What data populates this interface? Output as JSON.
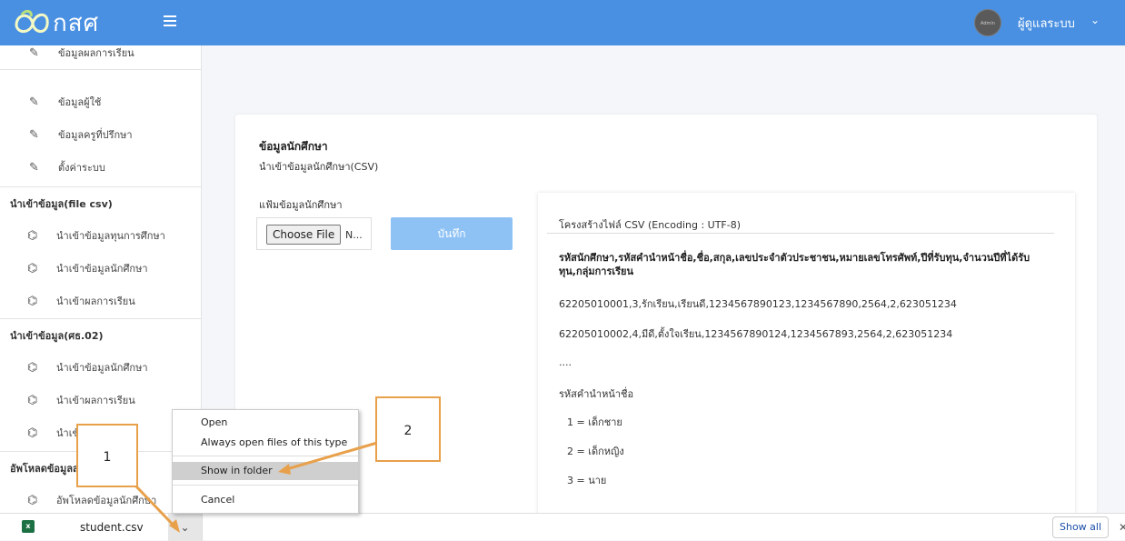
{
  "header": {
    "logo_text": "กสศ",
    "menu_icon": "hamburger-icon",
    "avatar_text": "Admin",
    "user_label": "ผู้ดูแลระบบ",
    "user_caret": "⌄",
    "colors": {
      "topbar": "#4a90e2",
      "save_button": "#8ec2f5"
    }
  },
  "sidebar": {
    "top_item": "ข้อมูลผลการเรียน",
    "items": [
      {
        "label": "ข้อมูลผู้ใช้",
        "icon": "edit-icon"
      },
      {
        "label": "ข้อมูลครูที่ปรึกษา",
        "icon": "edit-icon"
      },
      {
        "label": "ตั้งค่าระบบ",
        "icon": "edit-icon"
      }
    ],
    "sections": [
      {
        "title": "นำเข้าข้อมูล(file csv)",
        "items": [
          {
            "label": "นำเข้าข้อมูลทุนการศึกษา"
          },
          {
            "label": "นำเข้าข้อมูลนักศึกษา"
          },
          {
            "label": "นำเข้าผลการเรียน"
          }
        ]
      },
      {
        "title": "นำเข้าข้อมูล(ศธ.02)",
        "items": [
          {
            "label": "นำเข้าข้อมูลนักศึกษา"
          },
          {
            "label": "นำเข้าผลการเรียน"
          },
          {
            "label": "นำเข้าผลการเรียน"
          }
        ]
      },
      {
        "title": "อัพโหลดข้อมูลส่วนกลาง",
        "items": [
          {
            "label": "อัพโหลดข้อมูลนักศึกษา"
          }
        ]
      }
    ]
  },
  "main": {
    "title": "ข้อมูลนักศึกษา",
    "subtitle": "นำเข้าข้อมูลนักศึกษา(CSV)",
    "file_label": "แฟ้มข้อมูลนักศึกษา",
    "choose_file": "Choose File",
    "file_status": "N...",
    "save_label": "บันทึก",
    "info": {
      "title": "โครงสร้างไฟล์ CSV (Encoding : UTF-8)",
      "header_line": "รหัสนักศึกษา,รหัสคำนำหน้าชื่อ,ชื่อ,สกุล,เลขประจำตัวประชาชน,หมายเลขโทรศัพท์,ปีที่รับทุน,จำนวนปีที่ได้รับทุน,กลุ่มการเรียน",
      "example_1": "62205010001,3,รักเรียน,เรียนดี,1234567890123,1234567890,2564,2,623051234",
      "example_2": "62205010002,4,มีดี,ตั้งใจเรียน,1234567890124,1234567893,2564,2,623051234",
      "ellipsis": "....",
      "prefix_title": "รหัสคำนำหน้าชื่อ",
      "prefix_1": "1 = เด็กชาย",
      "prefix_2": "2 = เด็กหญิง",
      "prefix_3": "3 = นาย"
    }
  },
  "context_menu": {
    "items": [
      "Open",
      "Always open files of this type",
      "Show in folder",
      "Cancel"
    ],
    "highlighted": "Show in folder"
  },
  "download_bar": {
    "file_name": "student.csv",
    "file_icon": "excel-file-icon",
    "caret": "⌄",
    "show_all": "Show all",
    "close": "✕"
  },
  "callouts": {
    "one": "1",
    "two": "2"
  }
}
